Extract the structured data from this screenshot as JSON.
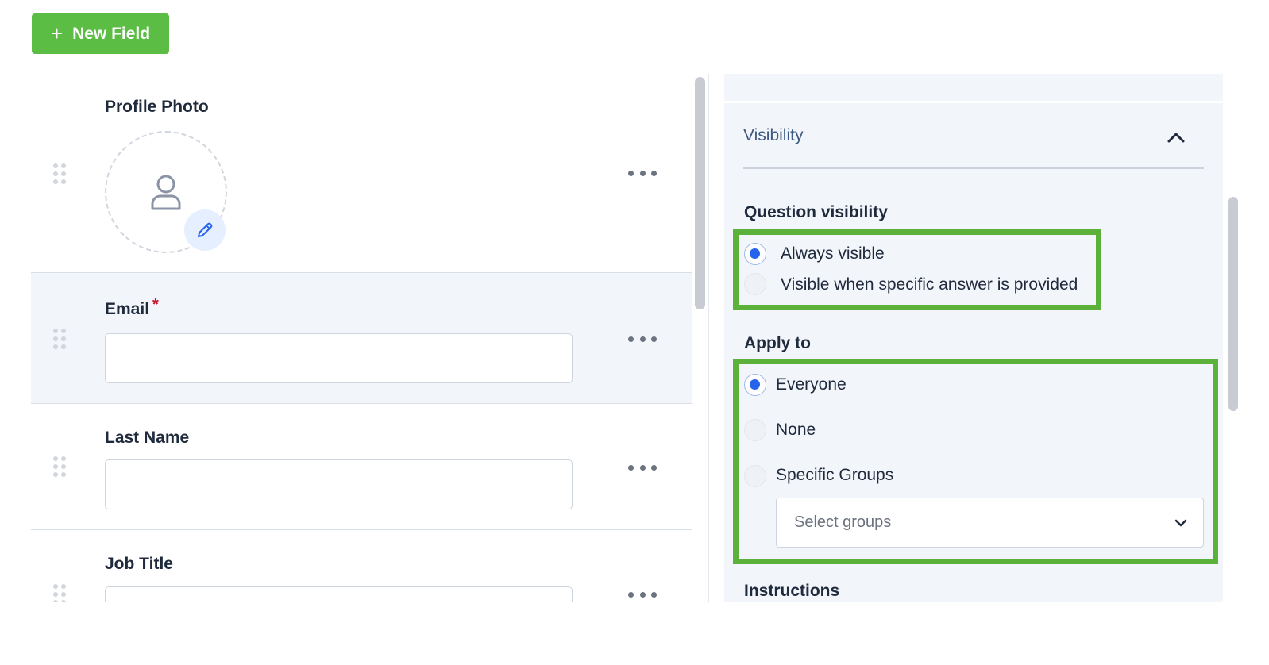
{
  "toolbar": {
    "new_field_label": "New Field",
    "new_field_icon": "plus-icon"
  },
  "fields": [
    {
      "label": "Profile Photo",
      "type": "photo",
      "required": false,
      "icon": "user-icon",
      "edit_icon": "pencil-icon"
    },
    {
      "label": "Email",
      "type": "text",
      "required": true,
      "required_mark": "*"
    },
    {
      "label": "Last Name",
      "type": "text",
      "required": false
    },
    {
      "label": "Job Title",
      "type": "text",
      "required": false
    }
  ],
  "panel": {
    "section_title": "Visibility",
    "section_toggle_icon": "chevron-up-icon",
    "question_visibility": {
      "label": "Question visibility",
      "options": [
        {
          "label": "Always visible",
          "checked": true
        },
        {
          "label": "Visible when specific answer is provided",
          "checked": false
        }
      ]
    },
    "apply_to": {
      "label": "Apply to",
      "options": [
        {
          "label": "Everyone",
          "checked": true
        },
        {
          "label": "None",
          "checked": false
        },
        {
          "label": "Specific Groups",
          "checked": false
        }
      ],
      "groups_select": {
        "placeholder": "Select groups",
        "icon": "chevron-down-icon"
      }
    },
    "next_section_label": "Instructions"
  },
  "colors": {
    "primary_button": "#5cbd45",
    "highlight_box": "#5cb13a",
    "radio_selected": "#2563eb",
    "required_mark": "#d0102b",
    "panel_title": "#3d5a80"
  }
}
